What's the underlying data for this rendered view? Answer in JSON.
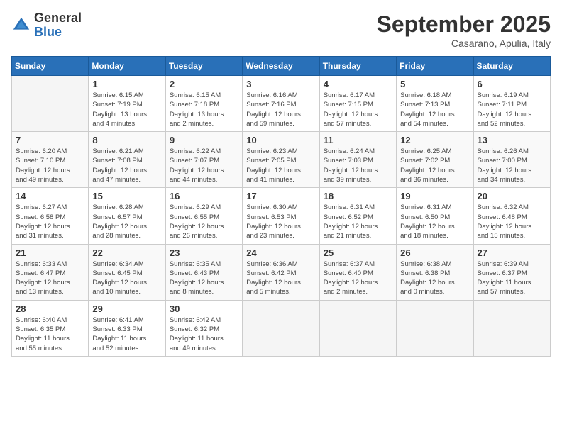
{
  "logo": {
    "general": "General",
    "blue": "Blue"
  },
  "title": "September 2025",
  "location": "Casarano, Apulia, Italy",
  "days_of_week": [
    "Sunday",
    "Monday",
    "Tuesday",
    "Wednesday",
    "Thursday",
    "Friday",
    "Saturday"
  ],
  "weeks": [
    [
      {
        "day": "",
        "info": ""
      },
      {
        "day": "1",
        "info": "Sunrise: 6:15 AM\nSunset: 7:19 PM\nDaylight: 13 hours\nand 4 minutes."
      },
      {
        "day": "2",
        "info": "Sunrise: 6:15 AM\nSunset: 7:18 PM\nDaylight: 13 hours\nand 2 minutes."
      },
      {
        "day": "3",
        "info": "Sunrise: 6:16 AM\nSunset: 7:16 PM\nDaylight: 12 hours\nand 59 minutes."
      },
      {
        "day": "4",
        "info": "Sunrise: 6:17 AM\nSunset: 7:15 PM\nDaylight: 12 hours\nand 57 minutes."
      },
      {
        "day": "5",
        "info": "Sunrise: 6:18 AM\nSunset: 7:13 PM\nDaylight: 12 hours\nand 54 minutes."
      },
      {
        "day": "6",
        "info": "Sunrise: 6:19 AM\nSunset: 7:11 PM\nDaylight: 12 hours\nand 52 minutes."
      }
    ],
    [
      {
        "day": "7",
        "info": "Sunrise: 6:20 AM\nSunset: 7:10 PM\nDaylight: 12 hours\nand 49 minutes."
      },
      {
        "day": "8",
        "info": "Sunrise: 6:21 AM\nSunset: 7:08 PM\nDaylight: 12 hours\nand 47 minutes."
      },
      {
        "day": "9",
        "info": "Sunrise: 6:22 AM\nSunset: 7:07 PM\nDaylight: 12 hours\nand 44 minutes."
      },
      {
        "day": "10",
        "info": "Sunrise: 6:23 AM\nSunset: 7:05 PM\nDaylight: 12 hours\nand 41 minutes."
      },
      {
        "day": "11",
        "info": "Sunrise: 6:24 AM\nSunset: 7:03 PM\nDaylight: 12 hours\nand 39 minutes."
      },
      {
        "day": "12",
        "info": "Sunrise: 6:25 AM\nSunset: 7:02 PM\nDaylight: 12 hours\nand 36 minutes."
      },
      {
        "day": "13",
        "info": "Sunrise: 6:26 AM\nSunset: 7:00 PM\nDaylight: 12 hours\nand 34 minutes."
      }
    ],
    [
      {
        "day": "14",
        "info": "Sunrise: 6:27 AM\nSunset: 6:58 PM\nDaylight: 12 hours\nand 31 minutes."
      },
      {
        "day": "15",
        "info": "Sunrise: 6:28 AM\nSunset: 6:57 PM\nDaylight: 12 hours\nand 28 minutes."
      },
      {
        "day": "16",
        "info": "Sunrise: 6:29 AM\nSunset: 6:55 PM\nDaylight: 12 hours\nand 26 minutes."
      },
      {
        "day": "17",
        "info": "Sunrise: 6:30 AM\nSunset: 6:53 PM\nDaylight: 12 hours\nand 23 minutes."
      },
      {
        "day": "18",
        "info": "Sunrise: 6:31 AM\nSunset: 6:52 PM\nDaylight: 12 hours\nand 21 minutes."
      },
      {
        "day": "19",
        "info": "Sunrise: 6:31 AM\nSunset: 6:50 PM\nDaylight: 12 hours\nand 18 minutes."
      },
      {
        "day": "20",
        "info": "Sunrise: 6:32 AM\nSunset: 6:48 PM\nDaylight: 12 hours\nand 15 minutes."
      }
    ],
    [
      {
        "day": "21",
        "info": "Sunrise: 6:33 AM\nSunset: 6:47 PM\nDaylight: 12 hours\nand 13 minutes."
      },
      {
        "day": "22",
        "info": "Sunrise: 6:34 AM\nSunset: 6:45 PM\nDaylight: 12 hours\nand 10 minutes."
      },
      {
        "day": "23",
        "info": "Sunrise: 6:35 AM\nSunset: 6:43 PM\nDaylight: 12 hours\nand 8 minutes."
      },
      {
        "day": "24",
        "info": "Sunrise: 6:36 AM\nSunset: 6:42 PM\nDaylight: 12 hours\nand 5 minutes."
      },
      {
        "day": "25",
        "info": "Sunrise: 6:37 AM\nSunset: 6:40 PM\nDaylight: 12 hours\nand 2 minutes."
      },
      {
        "day": "26",
        "info": "Sunrise: 6:38 AM\nSunset: 6:38 PM\nDaylight: 12 hours\nand 0 minutes."
      },
      {
        "day": "27",
        "info": "Sunrise: 6:39 AM\nSunset: 6:37 PM\nDaylight: 11 hours\nand 57 minutes."
      }
    ],
    [
      {
        "day": "28",
        "info": "Sunrise: 6:40 AM\nSunset: 6:35 PM\nDaylight: 11 hours\nand 55 minutes."
      },
      {
        "day": "29",
        "info": "Sunrise: 6:41 AM\nSunset: 6:33 PM\nDaylight: 11 hours\nand 52 minutes."
      },
      {
        "day": "30",
        "info": "Sunrise: 6:42 AM\nSunset: 6:32 PM\nDaylight: 11 hours\nand 49 minutes."
      },
      {
        "day": "",
        "info": ""
      },
      {
        "day": "",
        "info": ""
      },
      {
        "day": "",
        "info": ""
      },
      {
        "day": "",
        "info": ""
      }
    ]
  ]
}
